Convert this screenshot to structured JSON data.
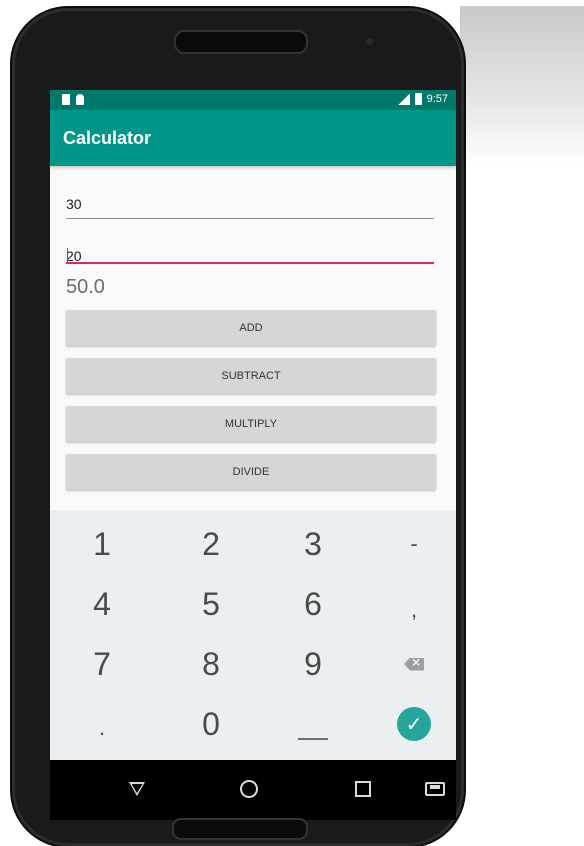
{
  "status_bar": {
    "time": "9:57"
  },
  "app": {
    "title": "Calculator"
  },
  "inputs": {
    "first_value": "30",
    "second_value": "20"
  },
  "result": "50.0",
  "buttons": {
    "add": "ADD",
    "subtract": "SUBTRACT",
    "multiply": "MULTIPLY",
    "divide": "DIVIDE"
  },
  "keyboard": {
    "row1": [
      "1",
      "2",
      "3",
      "-"
    ],
    "row2": [
      "4",
      "5",
      "6",
      ","
    ],
    "row3": [
      "7",
      "8",
      "9"
    ],
    "row4": [
      ".",
      "0"
    ]
  },
  "colors": {
    "status_bar": "#00796b",
    "app_bar": "#009688",
    "active_underline": "#e0245e",
    "confirm_key": "#26a69a"
  },
  "icons": {
    "status_left": [
      "sd-card-icon",
      "android-icon"
    ],
    "status_right": [
      "signal-icon",
      "battery-icon"
    ],
    "keyboard": [
      "backspace-icon",
      "check-icon"
    ],
    "nav": [
      "back-icon",
      "home-icon",
      "recents-icon",
      "keyboard-switch-icon"
    ]
  }
}
